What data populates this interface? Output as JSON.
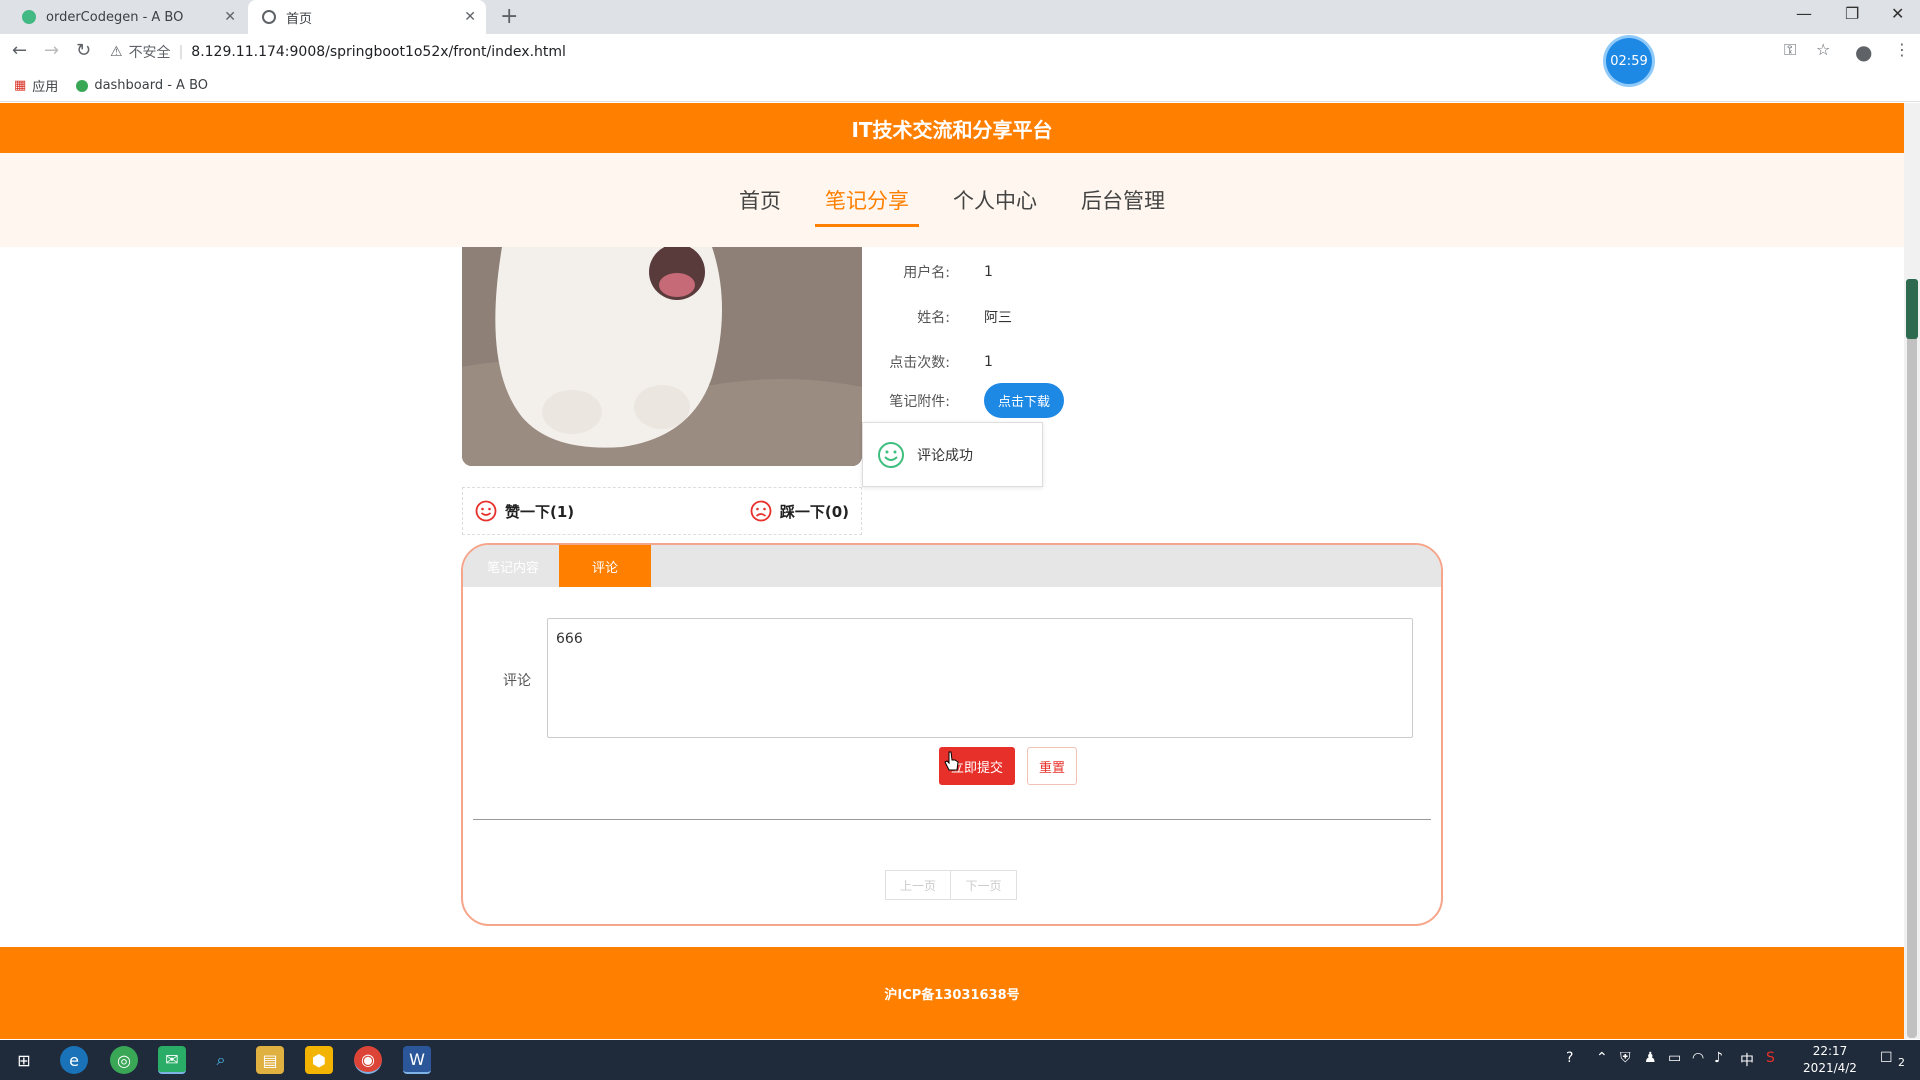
{
  "browser": {
    "tabs": [
      {
        "title": "orderCodegen - A BO"
      },
      {
        "title": "首页"
      }
    ],
    "insecure_label": "不安全",
    "url": "8.129.11.174:9008/springboot1o52x/front/index.html",
    "timer": "02:59",
    "bookmarks": [
      {
        "label": "应用"
      },
      {
        "label": "dashboard - A BO"
      }
    ]
  },
  "site": {
    "title": "IT技术交流和分享平台",
    "nav": [
      {
        "label": "首页"
      },
      {
        "label": "笔记分享",
        "active": true
      },
      {
        "label": "个人中心"
      },
      {
        "label": "后台管理"
      }
    ]
  },
  "detail": {
    "fields": [
      {
        "label": "用户名:",
        "value": "1"
      },
      {
        "label": "姓名:",
        "value": "阿三"
      },
      {
        "label": "点击次数:",
        "value": "1"
      },
      {
        "label": "笔记附件:",
        "button": "点击下载"
      }
    ],
    "toast": "评论成功",
    "like": "赞一下(1)",
    "dislike": "踩一下(0)"
  },
  "panel": {
    "tabs": [
      {
        "label": "笔记内容"
      },
      {
        "label": "评论",
        "active": true
      }
    ],
    "comment_label": "评论",
    "comment_value": "666",
    "submit": "立即提交",
    "reset": "重置",
    "prev": "上一页",
    "next": "下一页"
  },
  "footer": {
    "icp": "沪ICP备13031638号"
  },
  "taskbar": {
    "clock_time": "22:17",
    "clock_date": "2021/4/2",
    "ime": "中",
    "notifications": "2"
  },
  "colors": {
    "brand": "#ff7f00",
    "submit": "#e8302a",
    "download": "#1e88e5"
  }
}
